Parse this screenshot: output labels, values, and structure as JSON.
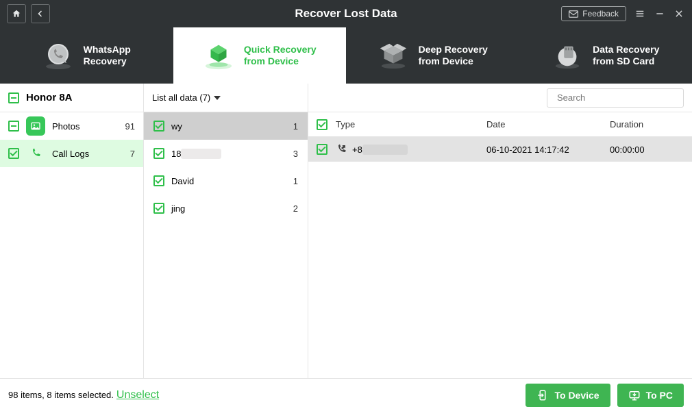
{
  "titlebar": {
    "title": "Recover Lost Data",
    "feedback_label": "Feedback"
  },
  "modes": {
    "whatsapp": {
      "line1": "WhatsApp",
      "line2": "Recovery"
    },
    "quick": {
      "line1": "Quick Recovery",
      "line2": "from Device"
    },
    "deep": {
      "line1": "Deep Recovery",
      "line2": "from Device"
    },
    "sdcard": {
      "line1": "Data Recovery",
      "line2": "from SD Card"
    }
  },
  "sidebar": {
    "device_name": "Honor 8A",
    "categories": [
      {
        "name": "Photos",
        "count": "91"
      },
      {
        "name": "Call Logs",
        "count": "7"
      }
    ]
  },
  "filter": {
    "label": "List all data (7)"
  },
  "contacts": [
    {
      "name": "wy",
      "count": "1"
    },
    {
      "name_prefix": "18",
      "count": "3"
    },
    {
      "name": "David",
      "count": "1"
    },
    {
      "name": "jing",
      "count": "2"
    }
  ],
  "search": {
    "placeholder": "Search"
  },
  "table": {
    "headers": {
      "type": "Type",
      "date": "Date",
      "duration": "Duration"
    },
    "rows": [
      {
        "prefix": "+8",
        "date": "06-10-2021 14:17:42",
        "duration": "00:00:00"
      }
    ]
  },
  "footer": {
    "status": "98 items, 8 items selected.",
    "unselect": "Unselect",
    "to_device": "To Device",
    "to_pc": "To PC"
  }
}
